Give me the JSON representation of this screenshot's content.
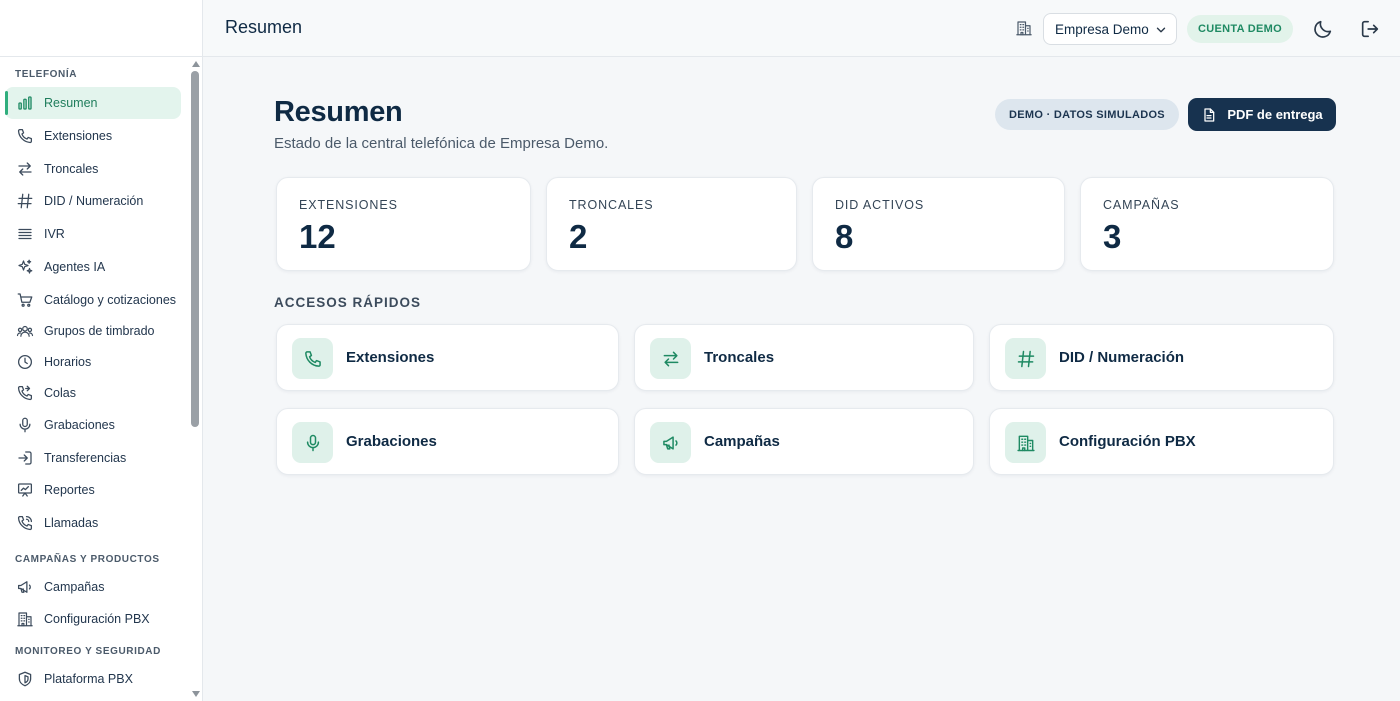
{
  "topbar": {
    "title": "Resumen",
    "company_select": "Empresa Demo",
    "account_badge": "CUENTA DEMO"
  },
  "sidebar": {
    "sections": [
      {
        "title": "TELEFONÍA",
        "items": [
          {
            "label": "Resumen",
            "icon": "bar-chart-icon",
            "active": true
          },
          {
            "label": "Extensiones",
            "icon": "phone-icon"
          },
          {
            "label": "Troncales",
            "icon": "arrows-swap-icon"
          },
          {
            "label": "DID / Numeración",
            "icon": "hash-icon"
          },
          {
            "label": "IVR",
            "icon": "list-icon"
          },
          {
            "label": "Agentes IA",
            "icon": "sparkles-icon"
          },
          {
            "label": "Catálogo y cotizaciones",
            "icon": "cart-icon"
          },
          {
            "label": "Grupos de timbrado",
            "icon": "users-icon"
          },
          {
            "label": "Horarios",
            "icon": "clock-icon"
          },
          {
            "label": "Colas",
            "icon": "phone-forward-icon"
          },
          {
            "label": "Grabaciones",
            "icon": "mic-icon"
          },
          {
            "label": "Transferencias",
            "icon": "log-in-icon"
          },
          {
            "label": "Reportes",
            "icon": "presentation-chart-icon"
          },
          {
            "label": "Llamadas",
            "icon": "phone-call-icon"
          }
        ]
      },
      {
        "title": "CAMPAÑAS Y PRODUCTOS",
        "items": [
          {
            "label": "Campañas",
            "icon": "megaphone-icon"
          },
          {
            "label": "Configuración PBX",
            "icon": "building-icon"
          }
        ]
      },
      {
        "title": "MONITOREO Y SEGURIDAD",
        "items": [
          {
            "label": "Plataforma PBX",
            "icon": "shield-icon"
          }
        ]
      }
    ]
  },
  "main": {
    "title": "Resumen",
    "subtitle": "Estado de la central telefónica de Empresa Demo.",
    "demo_badge": "DEMO · DATOS SIMULADOS",
    "pdf_button": "PDF de entrega",
    "stats": [
      {
        "label": "EXTENSIONES",
        "value": "12"
      },
      {
        "label": "TRONCALES",
        "value": "2"
      },
      {
        "label": "DID ACTIVOS",
        "value": "8"
      },
      {
        "label": "CAMPAÑAS",
        "value": "3"
      }
    ],
    "quick_title": "ACCESOS RÁPIDOS",
    "quick_links": [
      {
        "label": "Extensiones",
        "icon": "phone-icon"
      },
      {
        "label": "Troncales",
        "icon": "arrows-swap-icon"
      },
      {
        "label": "DID / Numeración",
        "icon": "hash-icon"
      },
      {
        "label": "Grabaciones",
        "icon": "mic-icon"
      },
      {
        "label": "Campañas",
        "icon": "megaphone-icon"
      },
      {
        "label": "Configuración PBX",
        "icon": "building-icon"
      }
    ]
  },
  "colors": {
    "accent": "#1f8a63",
    "accent_bg": "#dff1ea",
    "navy": "#17324f",
    "text": "#0f2a44"
  }
}
